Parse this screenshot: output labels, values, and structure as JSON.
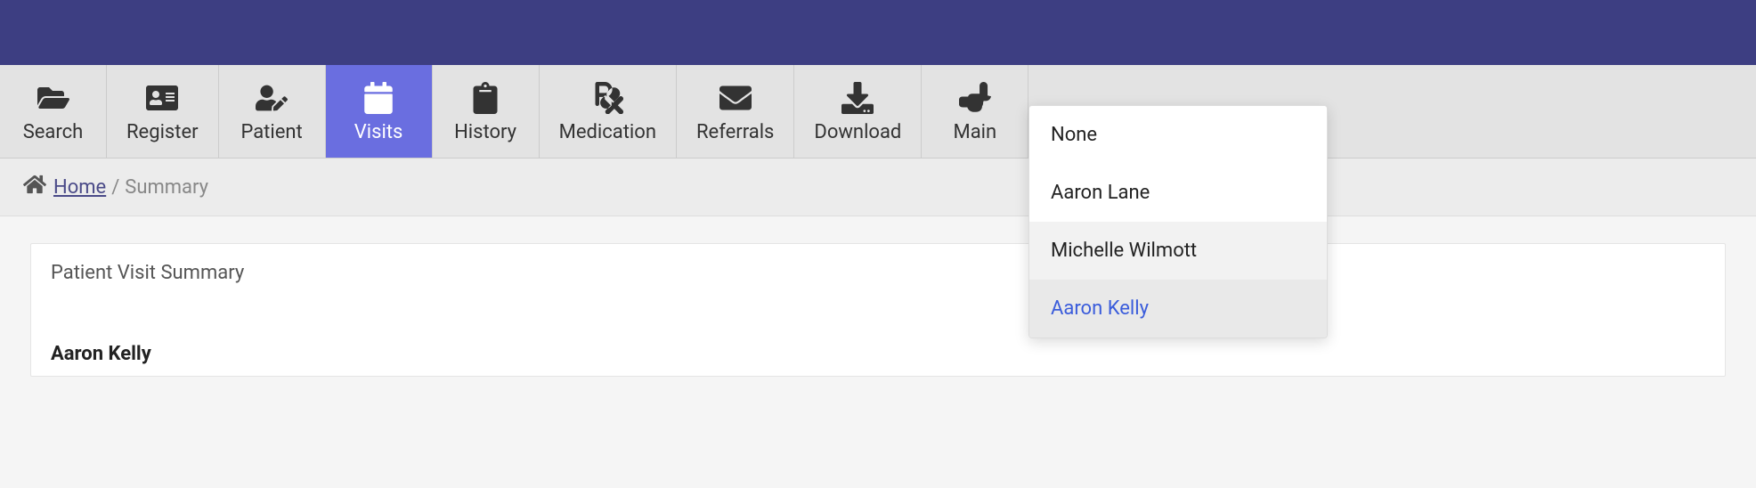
{
  "toolbar": {
    "items": [
      {
        "label": "Search",
        "icon": "folder-open-icon",
        "active": false
      },
      {
        "label": "Register",
        "icon": "id-card-icon",
        "active": false
      },
      {
        "label": "Patient",
        "icon": "user-edit-icon",
        "active": false
      },
      {
        "label": "Visits",
        "icon": "calendar-icon",
        "active": true
      },
      {
        "label": "History",
        "icon": "clipboard-icon",
        "active": false
      },
      {
        "label": "Medication",
        "icon": "rx-icon",
        "active": false
      },
      {
        "label": "Referrals",
        "icon": "envelope-icon",
        "active": false
      },
      {
        "label": "Download",
        "icon": "download-icon",
        "active": false
      },
      {
        "label": "Main",
        "icon": "hand-point-icon",
        "active": false
      }
    ]
  },
  "breadcrumb": {
    "home": "Home",
    "separator": "/",
    "current": "Summary"
  },
  "card": {
    "title": "Patient Visit Summary",
    "patient_name": "Aaron Kelly"
  },
  "dropdown": {
    "items": [
      {
        "label": "None",
        "state": ""
      },
      {
        "label": "Aaron Lane",
        "state": ""
      },
      {
        "label": "Michelle Wilmott",
        "state": "hover"
      },
      {
        "label": "Aaron Kelly",
        "state": "selected"
      }
    ]
  }
}
